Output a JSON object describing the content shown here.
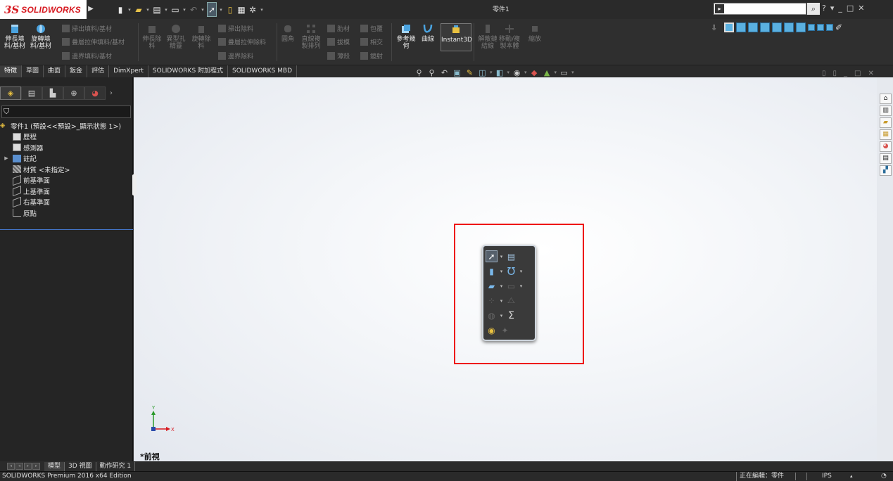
{
  "app": {
    "logo_prefix": "3S",
    "logo_name": "SOLIDWORKS",
    "document_title": "零件1"
  },
  "titlebar": {
    "search_cmd_icon": "command-prompt-icon",
    "help_label": "?",
    "controls": [
      "?",
      "▾",
      "_",
      "□",
      "✕"
    ]
  },
  "commands": {
    "extrude_boss": "伸長填\n料/基材",
    "revolve_boss": "旋轉填\n料/基材",
    "sweep_boss": "掃出填料/基材",
    "loft_boss": "疊層拉伸填料/基材",
    "boundary_boss": "邊界填料/基材",
    "extrude_cut": "伸長除\n料",
    "hole_wizard": "異型孔\n精靈",
    "revolve_cut": "旋轉除\n料",
    "sweep_cut": "掃出除料",
    "loft_cut": "疊層拉伸除料",
    "boundary_cut": "邊界除料",
    "fillet": "圓角",
    "linear_pattern": "直線複\n製排列",
    "rib": "肋材",
    "draft": "拔模",
    "shell": "薄殼",
    "wrap": "包覆",
    "intersect": "相交",
    "mirror": "鏡射",
    "reference_geometry": "參考幾\n何",
    "curves": "曲線",
    "instant3d": "Instant3D",
    "unlink_spline": "解散鏈\n結線",
    "move_copy": "移動/複\n製本體",
    "scale": "縮放"
  },
  "tabs": [
    {
      "label": "特徵",
      "active": true
    },
    {
      "label": "草圖",
      "active": false
    },
    {
      "label": "曲面",
      "active": false
    },
    {
      "label": "鈑金",
      "active": false
    },
    {
      "label": "評估",
      "active": false
    },
    {
      "label": "DimXpert",
      "active": false
    },
    {
      "label": "SOLIDWORKS 附加程式",
      "active": false
    },
    {
      "label": "SOLIDWORKS MBD",
      "active": false
    }
  ],
  "tree": {
    "filter_icon": "filter-icon",
    "root": "零件1 (預設<<預設>_顯示狀態 1>)",
    "items": [
      {
        "label": "歷程",
        "icon": "history-icon"
      },
      {
        "label": "感測器",
        "icon": "sensor-icon"
      },
      {
        "label": "註記",
        "icon": "annotation-icon"
      },
      {
        "label": "材質 <未指定>",
        "icon": "material-icon"
      },
      {
        "label": "前基準面",
        "icon": "plane-icon"
      },
      {
        "label": "上基準面",
        "icon": "plane-icon"
      },
      {
        "label": "右基準面",
        "icon": "plane-icon"
      },
      {
        "label": "原點",
        "icon": "origin-icon"
      }
    ]
  },
  "graphics": {
    "view_label": "*前視",
    "axis_x": "X",
    "axis_y": "Y"
  },
  "bottom_tabs": [
    {
      "label": "模型",
      "active": true
    },
    {
      "label": "3D 視圖",
      "active": false
    },
    {
      "label": "動作研究 1",
      "active": false
    }
  ],
  "status": {
    "product": "SOLIDWORKS Premium 2016 x64 Edition",
    "editing": "正在編輯：零件",
    "units": "IPS",
    "units_arrow": "▴"
  },
  "colors": {
    "brand_red": "#d71920",
    "highlight_red": "#ee1111",
    "accent_blue": "#4477cc"
  }
}
